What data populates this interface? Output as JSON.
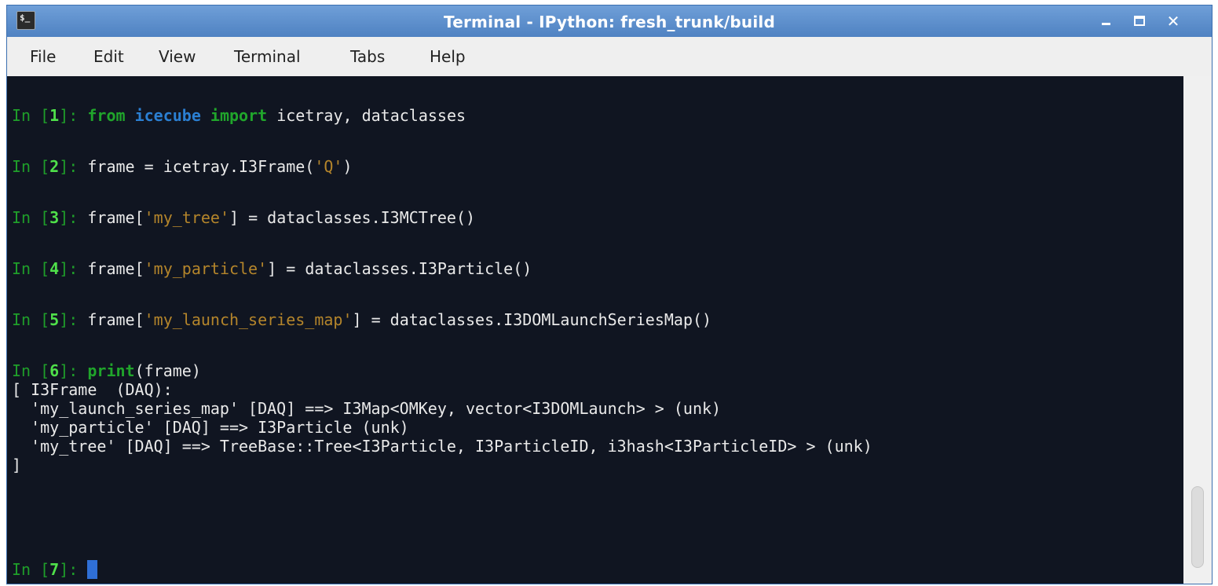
{
  "window": {
    "title": "Terminal - IPython: fresh_trunk/build",
    "icon_text": "$_",
    "controls": {
      "minimize": "",
      "maximize": "",
      "close": "✕"
    }
  },
  "menubar": [
    "File",
    "Edit",
    "View",
    "Terminal",
    "Tabs",
    "Help"
  ],
  "terminal": {
    "prompts": [
      {
        "in": "In ",
        "lb": "[",
        "num": "1",
        "rb": "]",
        "colon": ": "
      },
      {
        "in": "In ",
        "lb": "[",
        "num": "2",
        "rb": "]",
        "colon": ": "
      },
      {
        "in": "In ",
        "lb": "[",
        "num": "3",
        "rb": "]",
        "colon": ": "
      },
      {
        "in": "In ",
        "lb": "[",
        "num": "4",
        "rb": "]",
        "colon": ": "
      },
      {
        "in": "In ",
        "lb": "[",
        "num": "5",
        "rb": "]",
        "colon": ": "
      },
      {
        "in": "In ",
        "lb": "[",
        "num": "6",
        "rb": "]",
        "colon": ": "
      },
      {
        "in": "In ",
        "lb": "[",
        "num": "7",
        "rb": "]",
        "colon": ": "
      }
    ],
    "cmd1": {
      "from": "from",
      "module": "icecube",
      "import": "import",
      "rest": " icetray, dataclasses"
    },
    "cmd2": {
      "a": "frame = icetray.I3Frame(",
      "s": "'Q'",
      "b": ")"
    },
    "cmd3": {
      "a": "frame[",
      "s": "'my_tree'",
      "b": "] = dataclasses.I3MCTree()"
    },
    "cmd4": {
      "a": "frame[",
      "s": "'my_particle'",
      "b": "] = dataclasses.I3Particle()"
    },
    "cmd5": {
      "a": "frame[",
      "s": "'my_launch_series_map'",
      "b": "] = dataclasses.I3DOMLaunchSeriesMap()"
    },
    "cmd6": {
      "kw": "print",
      "rest": "(frame)"
    },
    "output": [
      "[ I3Frame  (DAQ):",
      "  'my_launch_series_map' [DAQ] ==> I3Map<OMKey, vector<I3DOMLaunch> > (unk)",
      "  'my_particle' [DAQ] ==> I3Particle (unk)",
      "  'my_tree' [DAQ] ==> TreeBase::Tree<I3Particle, I3ParticleID, i3hash<I3ParticleID> > (unk)",
      "]"
    ]
  },
  "colors": {
    "terminal_bg": "#101521",
    "prompt_green": "#4fe04a",
    "keyword_green": "#20a52b",
    "module_blue": "#2b7fd2",
    "string_orange": "#b4852b",
    "cursor_blue": "#2f6fd6",
    "titlebar_blue": "#5a8cca"
  }
}
